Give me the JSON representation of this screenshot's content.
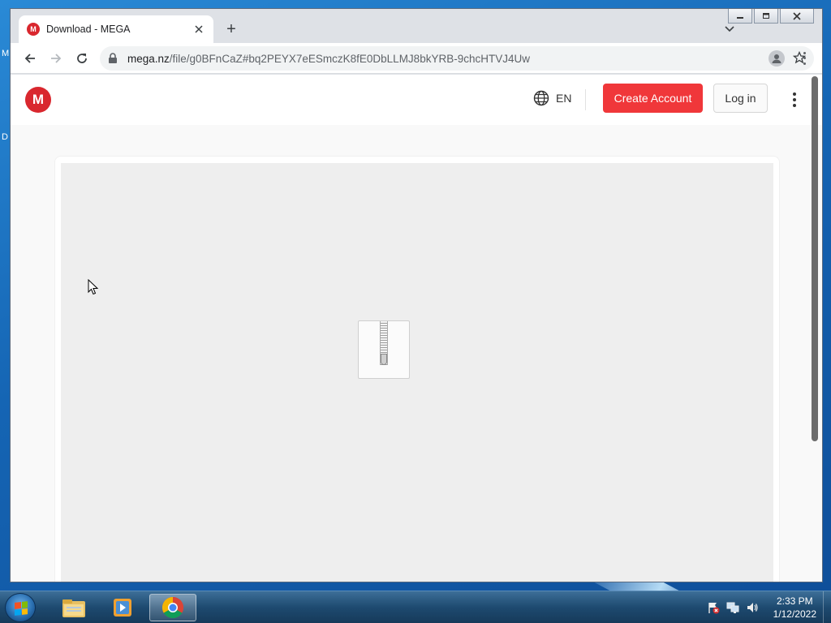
{
  "desktop": {
    "label_m": "M",
    "label_d": "D"
  },
  "browser": {
    "tab_title": "Download - MEGA",
    "tab_favicon": "M",
    "new_tab_label": "+",
    "url_host": "mega.nz",
    "url_path": "/file/g0BFnCaZ#bq2PEYX7eESmczK8fE0DbLLMJ8bkYRB-9chcHTVJ4Uw"
  },
  "site": {
    "logo_letter": "M",
    "language": "EN",
    "create_account_label": "Create Account",
    "login_label": "Log in",
    "accent_color": "#f0373a"
  },
  "taskbar": {
    "clock_time": "2:33 PM",
    "clock_date": "1/12/2022"
  }
}
